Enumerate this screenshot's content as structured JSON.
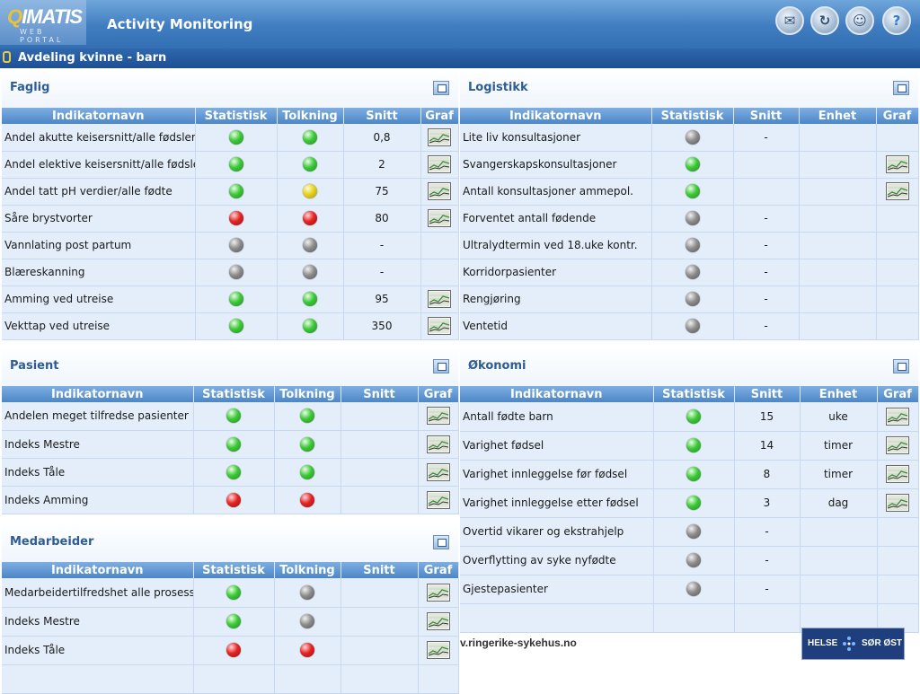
{
  "header": {
    "logo_text": "IMATIS",
    "logo_subtext": "WEB PORTAL",
    "app_title": "Activity Monitoring",
    "buttons": [
      {
        "name": "mail",
        "icon": "envelope-icon",
        "glyph": "✉"
      },
      {
        "name": "refresh",
        "icon": "refresh-icon",
        "glyph": "↻"
      },
      {
        "name": "user",
        "icon": "person-icon",
        "glyph": "☺"
      },
      {
        "name": "help",
        "icon": "help-icon",
        "glyph": "?"
      }
    ]
  },
  "department": {
    "title": "Avdeling kvinne - barn"
  },
  "colors": {
    "header_blue": "#3f7cc0",
    "dept_bar": "#1e4f93",
    "table_header": "#5e93cf",
    "cell_bg": "#e3eefa",
    "title_blue": "#2d5c96"
  },
  "faglig": {
    "title": "Faglig",
    "columns": [
      "Indikatornavn",
      "Statistisk",
      "Tolkning",
      "Snitt",
      "Graf"
    ],
    "rows": [
      {
        "name": "Andel akutte keisersnitt/alle fødsler",
        "statistisk": "green",
        "tolkning": "green",
        "snitt": "0,8",
        "graf": true
      },
      {
        "name": "Andel elektive keisersnitt/alle fødsler",
        "statistisk": "green",
        "tolkning": "green",
        "snitt": "2",
        "graf": true
      },
      {
        "name": "Andel tatt pH verdier/alle fødte",
        "statistisk": "green",
        "tolkning": "yellow",
        "snitt": "75",
        "graf": true
      },
      {
        "name": "Såre brystvorter",
        "statistisk": "red",
        "tolkning": "red",
        "snitt": "80",
        "graf": true
      },
      {
        "name": "Vannlating post partum",
        "statistisk": "grey",
        "tolkning": "grey",
        "snitt": "-",
        "graf": false
      },
      {
        "name": "Blæreskanning",
        "statistisk": "grey",
        "tolkning": "grey",
        "snitt": "-",
        "graf": false
      },
      {
        "name": "Amming ved utreise",
        "statistisk": "green",
        "tolkning": "green",
        "snitt": "95",
        "graf": true
      },
      {
        "name": "Vekttap ved utreise",
        "statistisk": "green",
        "tolkning": "green",
        "snitt": "350",
        "graf": true
      }
    ]
  },
  "logistikk": {
    "title": "Logistikk",
    "columns": [
      "Indikatornavn",
      "Statistisk",
      "Snitt",
      "Enhet",
      "Graf"
    ],
    "rows": [
      {
        "name": "Lite liv konsultasjoner",
        "statistisk": "grey",
        "snitt": "-",
        "enhet": "",
        "graf": false
      },
      {
        "name": "Svangerskapskonsultasjoner",
        "statistisk": "green",
        "snitt": "",
        "enhet": "",
        "graf": true
      },
      {
        "name": "Antall konsultasjoner ammepol.",
        "statistisk": "green",
        "snitt": "",
        "enhet": "",
        "graf": true
      },
      {
        "name": "Forventet antall fødende",
        "statistisk": "grey",
        "snitt": "-",
        "enhet": "",
        "graf": false
      },
      {
        "name": "Ultralydtermin ved 18.uke kontr.",
        "statistisk": "grey",
        "snitt": "-",
        "enhet": "",
        "graf": false
      },
      {
        "name": "Korridorpasienter",
        "statistisk": "grey",
        "snitt": "-",
        "enhet": "",
        "graf": false
      },
      {
        "name": "Rengjøring",
        "statistisk": "grey",
        "snitt": "-",
        "enhet": "",
        "graf": false
      },
      {
        "name": "Ventetid",
        "statistisk": "grey",
        "snitt": "-",
        "enhet": "",
        "graf": false
      }
    ]
  },
  "pasient": {
    "title": "Pasient",
    "columns": [
      "Indikatornavn",
      "Statistisk",
      "Tolkning",
      "Snitt",
      "Graf"
    ],
    "rows": [
      {
        "name": "Andelen meget tilfredse pasienter",
        "statistisk": "green",
        "tolkning": "green",
        "snitt": "",
        "graf": true
      },
      {
        "name": "Indeks Mestre",
        "statistisk": "green",
        "tolkning": "green",
        "snitt": "",
        "graf": true
      },
      {
        "name": "Indeks Tåle",
        "statistisk": "green",
        "tolkning": "green",
        "snitt": "",
        "graf": true
      },
      {
        "name": "Indeks Amming",
        "statistisk": "red",
        "tolkning": "red",
        "snitt": "",
        "graf": true
      }
    ]
  },
  "okonomi": {
    "title": "Økonomi",
    "columns": [
      "Indikatornavn",
      "Statistisk",
      "Snitt",
      "Enhet",
      "Graf"
    ],
    "rows": [
      {
        "name": "Antall fødte barn",
        "statistisk": "green",
        "snitt": "15",
        "enhet": "uke",
        "graf": true
      },
      {
        "name": "Varighet fødsel",
        "statistisk": "green",
        "snitt": "14",
        "enhet": "timer",
        "graf": true
      },
      {
        "name": "Varighet innleggelse før fødsel",
        "statistisk": "green",
        "snitt": "8",
        "enhet": "timer",
        "graf": true
      },
      {
        "name": "Varighet innleggelse etter fødsel",
        "statistisk": "green",
        "snitt": "3",
        "enhet": "dag",
        "graf": true
      },
      {
        "name": "Overtid vikarer og ekstrahjelp",
        "statistisk": "grey",
        "snitt": "-",
        "enhet": "",
        "graf": false
      },
      {
        "name": "Overflytting av syke nyfødte",
        "statistisk": "grey",
        "snitt": "-",
        "enhet": "",
        "graf": false
      },
      {
        "name": "Gjestepasienter",
        "statistisk": "grey",
        "snitt": "-",
        "enhet": "",
        "graf": false
      },
      {
        "name": "",
        "statistisk": "",
        "snitt": "",
        "enhet": "",
        "graf": false
      }
    ]
  },
  "medarbeider": {
    "title": "Medarbeider",
    "columns": [
      "Indikatornavn",
      "Statistisk",
      "Tolkning",
      "Snitt",
      "Graf"
    ],
    "rows": [
      {
        "name": "Medarbeidertilfredshet alle prosesser",
        "statistisk": "green",
        "tolkning": "grey",
        "snitt": "",
        "graf": true
      },
      {
        "name": "Indeks Mestre",
        "statistisk": "green",
        "tolkning": "grey",
        "snitt": "",
        "graf": true
      },
      {
        "name": "Indeks Tåle",
        "statistisk": "red",
        "tolkning": "red",
        "snitt": "",
        "graf": true
      },
      {
        "name": "",
        "statistisk": "",
        "tolkning": "",
        "snitt": "",
        "graf": false
      }
    ]
  },
  "footer": {
    "url": "v.ringerike-sykehus.no",
    "logo_left": "HELSE",
    "logo_right": "SØR ØST"
  }
}
